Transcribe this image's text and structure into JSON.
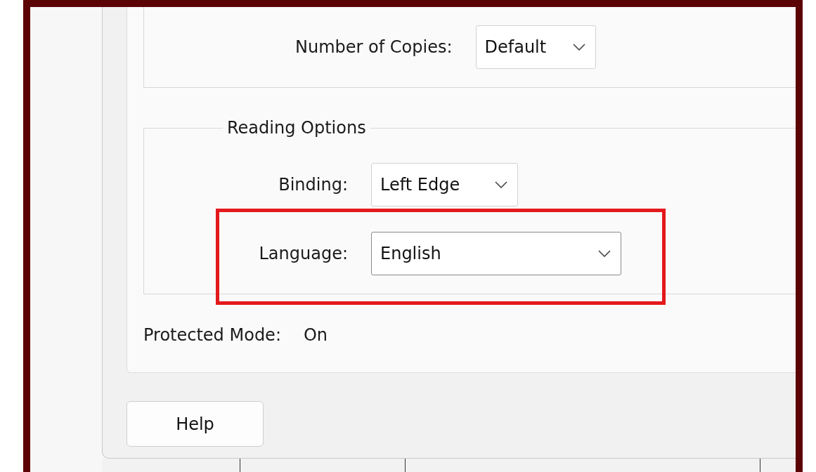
{
  "copies": {
    "label": "Number of Copies:",
    "value": "Default"
  },
  "reading_options": {
    "title": "Reading Options",
    "fields": [
      {
        "label": "Binding:",
        "value": "Left Edge",
        "highlighted": false
      },
      {
        "label": "Language:",
        "value": "English",
        "highlighted": true
      }
    ]
  },
  "protected_mode": {
    "label": "Protected Mode:",
    "value": "On"
  },
  "buttons": [
    "Help"
  ]
}
